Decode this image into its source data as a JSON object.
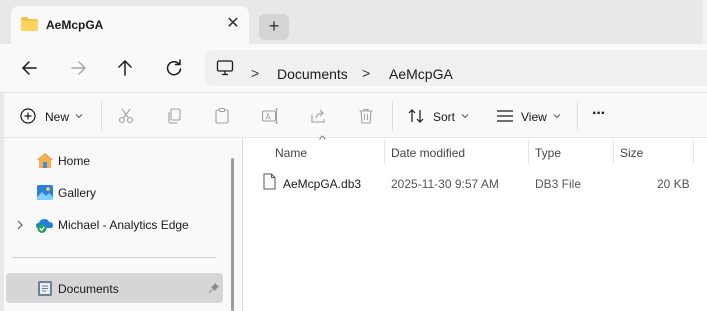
{
  "window": {
    "tab_title": "AeMcpGA",
    "new_tab_symbol": "+",
    "close_symbol": "✕"
  },
  "address": {
    "crumbs": [
      "Documents",
      "AeMcpGA"
    ],
    "separator": ">"
  },
  "toolbar": {
    "new_label": "New",
    "sort_label": "Sort",
    "view_label": "View",
    "more_label": "···"
  },
  "sidebar": {
    "items": [
      {
        "label": "Home",
        "icon": "home-icon"
      },
      {
        "label": "Gallery",
        "icon": "gallery-icon"
      },
      {
        "label": "Michael - Analytics Edge",
        "icon": "onedrive-icon"
      },
      {
        "label": "Documents",
        "icon": "documents-icon",
        "selected": true,
        "pinned": true
      }
    ]
  },
  "file_list": {
    "columns": [
      "Name",
      "Date modified",
      "Type",
      "Size"
    ],
    "sort_indicator": "^",
    "rows": [
      {
        "name": "AeMcpGA.db3",
        "date_modified": "2025-11-30 9:57 AM",
        "type": "DB3 File",
        "size": "20 KB"
      }
    ]
  },
  "colors": {
    "accent": "#0067c0",
    "folder": "#f5c342",
    "selected_bg": "#d6d6d6"
  }
}
